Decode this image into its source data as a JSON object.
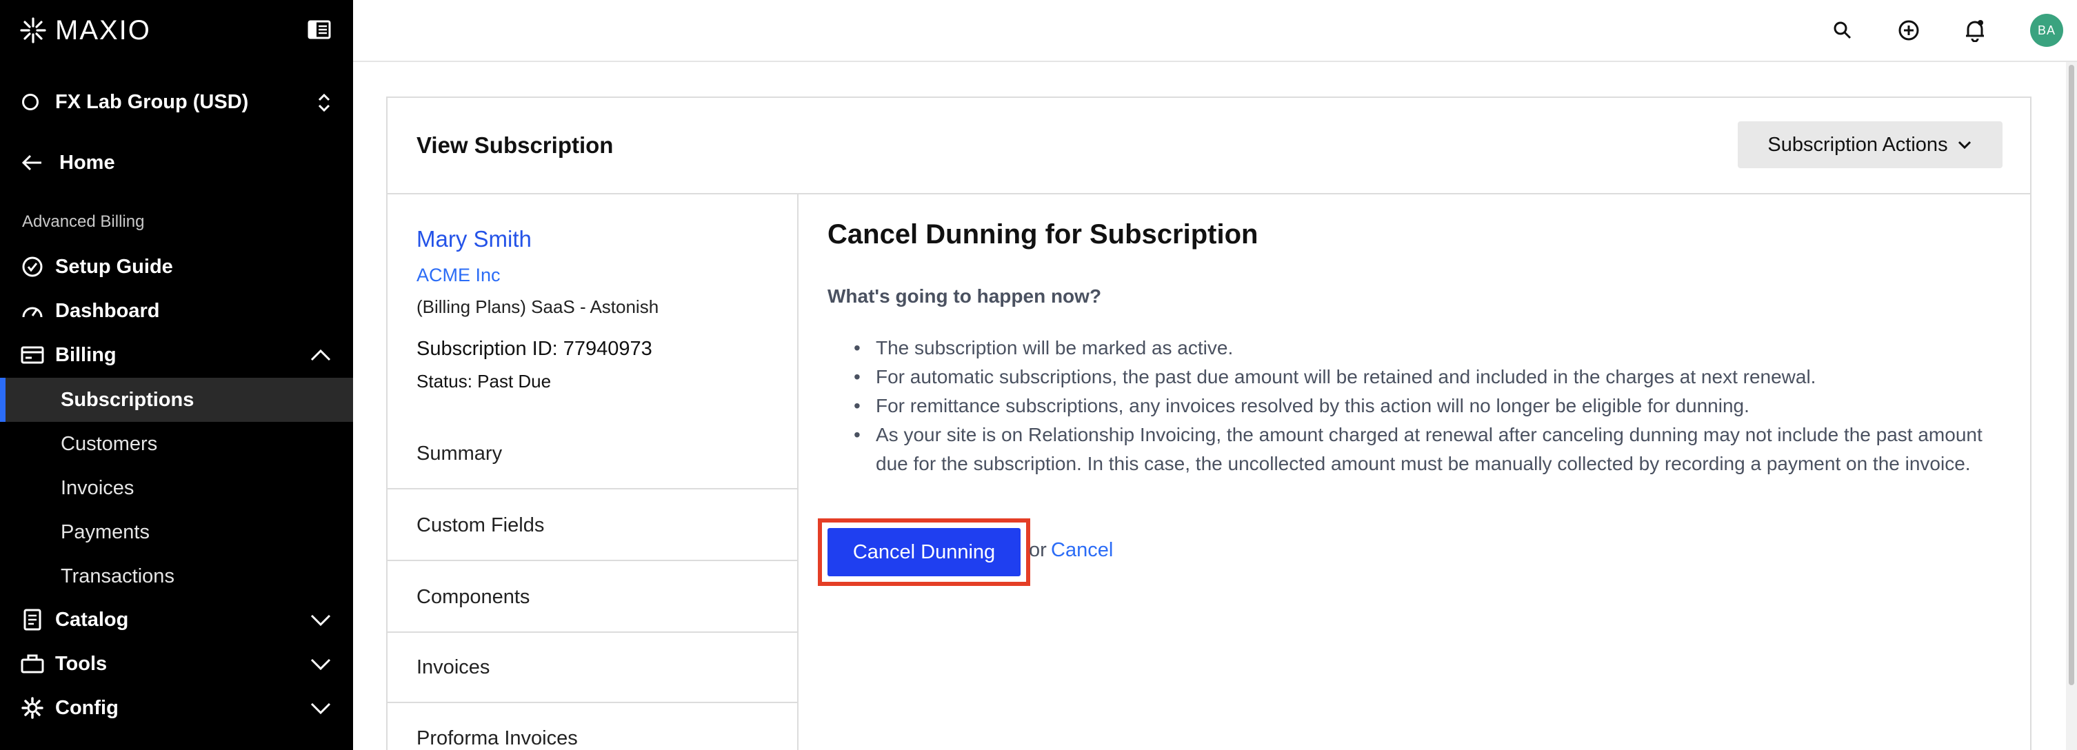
{
  "brand": {
    "name": "MAXIO"
  },
  "sidebar": {
    "site_name": "FX Lab Group (USD)",
    "home_label": "Home",
    "section_label": "Advanced Billing",
    "items": {
      "setup_guide": "Setup Guide",
      "dashboard": "Dashboard",
      "billing": "Billing",
      "catalog": "Catalog",
      "tools": "Tools",
      "config": "Config"
    },
    "billing_sub": {
      "subscriptions": "Subscriptions",
      "customers": "Customers",
      "invoices": "Invoices",
      "payments": "Payments",
      "transactions": "Transactions"
    },
    "active_item": "Subscriptions"
  },
  "topbar": {
    "icons": [
      "search-icon",
      "add-circle-icon",
      "notifications-bell-icon"
    ],
    "avatar_initials": "BA"
  },
  "card": {
    "title": "View Subscription",
    "actions_label": "Subscription Actions"
  },
  "customer": {
    "name": "Mary Smith",
    "organization": "ACME Inc",
    "plan": "(Billing Plans) SaaS - Astonish",
    "subscription_id": "Subscription ID: 77940973",
    "status": "Status: Past Due"
  },
  "side_tabs": {
    "summary": "Summary",
    "custom_fields": "Custom Fields",
    "components": "Components",
    "invoices": "Invoices",
    "proforma_invoices": "Proforma Invoices"
  },
  "content": {
    "title": "Cancel Dunning for Subscription",
    "subtitle": "What's going to happen now?",
    "bullets": {
      "b1": "The subscription will be marked as active.",
      "b2": "For automatic subscriptions, the past due amount will be retained and included in the charges at next renewal.",
      "b3": "For remittance subscriptions, any invoices resolved by this action will no longer be eligible for dunning.",
      "b4": "As your site is on Relationship Invoicing, the amount charged at renewal after canceling dunning may not include the past amount due for the subscription. In this case, the uncollected amount must be manually collected by recording a payment on the invoice."
    },
    "primary_button": "Cancel Dunning",
    "or_text": "or",
    "cancel_link": "Cancel"
  },
  "colors": {
    "sidebar_bg": "#000000",
    "active_indicator": "#2b6cf6",
    "primary_button": "#1f3ff0",
    "highlight_box": "#e43e26",
    "link": "#2b6cf6",
    "avatar_bg": "#3aa37f"
  }
}
